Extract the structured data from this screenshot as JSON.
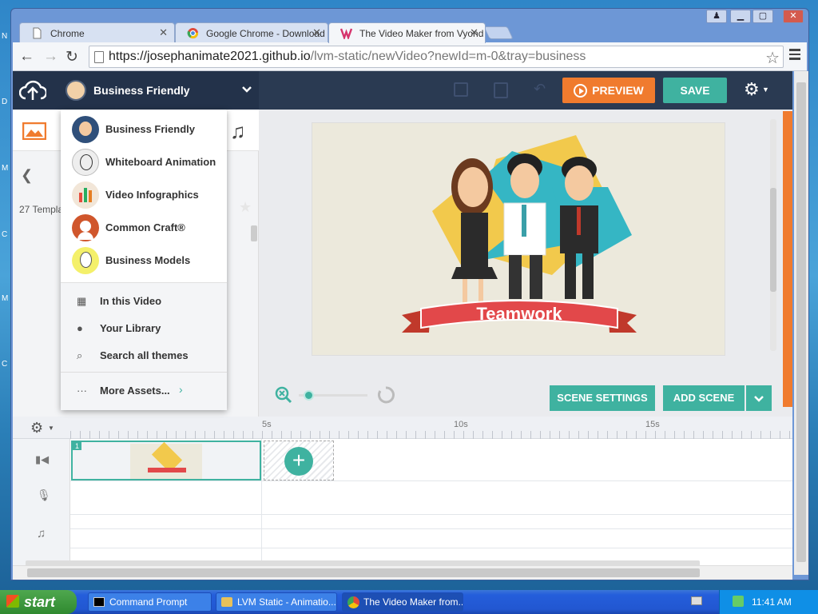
{
  "browser": {
    "tabs": [
      {
        "title": "Chrome"
      },
      {
        "title": "Google Chrome - Download t"
      },
      {
        "title": "The Video Maker from Vyond"
      }
    ],
    "url_host": "https://josephanimate2021.github.io",
    "url_path": "/lvm-static/newVideo?newId=m-0&tray=business"
  },
  "app": {
    "theme_selected": "Business Friendly",
    "preview_label": "PREVIEW",
    "save_label": "SAVE",
    "templates_count": "27 Templa",
    "scene_title": "Teamwork",
    "scene_settings_label": "SCENE SETTINGS",
    "add_scene_label": "ADD SCENE",
    "timeline": {
      "ticks": [
        "5s",
        "10s",
        "15s"
      ],
      "scene_number": "1"
    },
    "theme_menu": {
      "themes": [
        {
          "label": "Business Friendly"
        },
        {
          "label": "Whiteboard Animation"
        },
        {
          "label": "Video Infographics"
        },
        {
          "label": "Common Craft®"
        },
        {
          "label": "Business Models"
        }
      ],
      "links": [
        {
          "label": "In this Video"
        },
        {
          "label": "Your Library"
        },
        {
          "label": "Search all themes"
        }
      ],
      "more": "More Assets..."
    }
  },
  "taskbar": {
    "start": "start",
    "items": [
      {
        "label": "Command Prompt"
      },
      {
        "label": "LVM Static - Animatio..."
      },
      {
        "label": "The Video Maker from..."
      }
    ],
    "clock": "11:41 AM"
  },
  "colors": {
    "accent_orange": "#f07b2e",
    "teal": "#3fb2a0",
    "navy": "#2a3a52"
  }
}
